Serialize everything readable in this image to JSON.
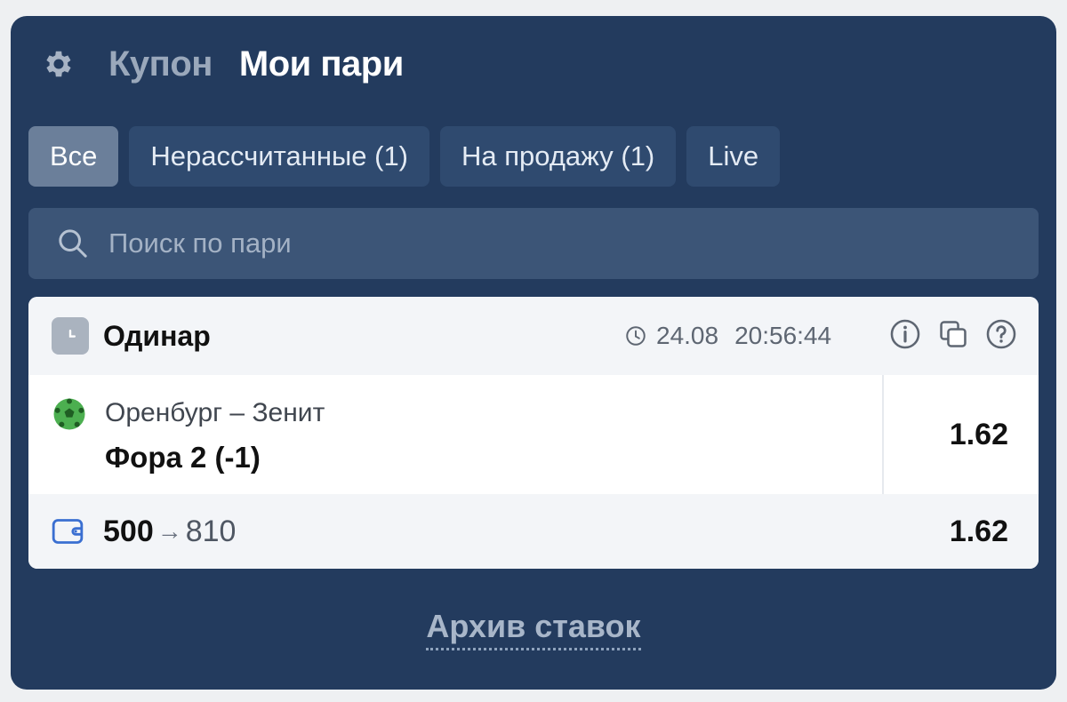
{
  "header": {
    "coupon_label": "Купон",
    "my_bets_label": "Мои пари"
  },
  "filters": [
    {
      "label": "Все",
      "active": true
    },
    {
      "label": "Нерассчитанные (1)",
      "active": false
    },
    {
      "label": "На продажу (1)",
      "active": false
    },
    {
      "label": "Live",
      "active": false
    }
  ],
  "search": {
    "placeholder": "Поиск по пари",
    "value": ""
  },
  "bet": {
    "type": "Одинар",
    "date": "24.08",
    "time": "20:56:44",
    "match": "Оренбург – Зенит",
    "market": "Фора 2 (-1)",
    "odds": "1.62",
    "stake": "500",
    "arrow": "→",
    "payout": "810",
    "total_odds": "1.62"
  },
  "footer": {
    "archive_label": "Архив ставок"
  },
  "colors": {
    "panel_bg": "#233b5e",
    "chip_bg": "#2f4a6f",
    "chip_active_bg": "#6b7f9a",
    "search_bg": "#3c5577",
    "card_bg": "#ffffff",
    "card_head_bg": "#f3f5f8"
  },
  "icons": {
    "settings": "gear-icon",
    "search": "search-icon",
    "bet_type": "clock-badge-icon",
    "datetime": "clock-icon",
    "info": "info-icon",
    "copy": "copy-icon",
    "help": "help-icon",
    "sport": "football-icon",
    "stake": "wallet-icon"
  }
}
